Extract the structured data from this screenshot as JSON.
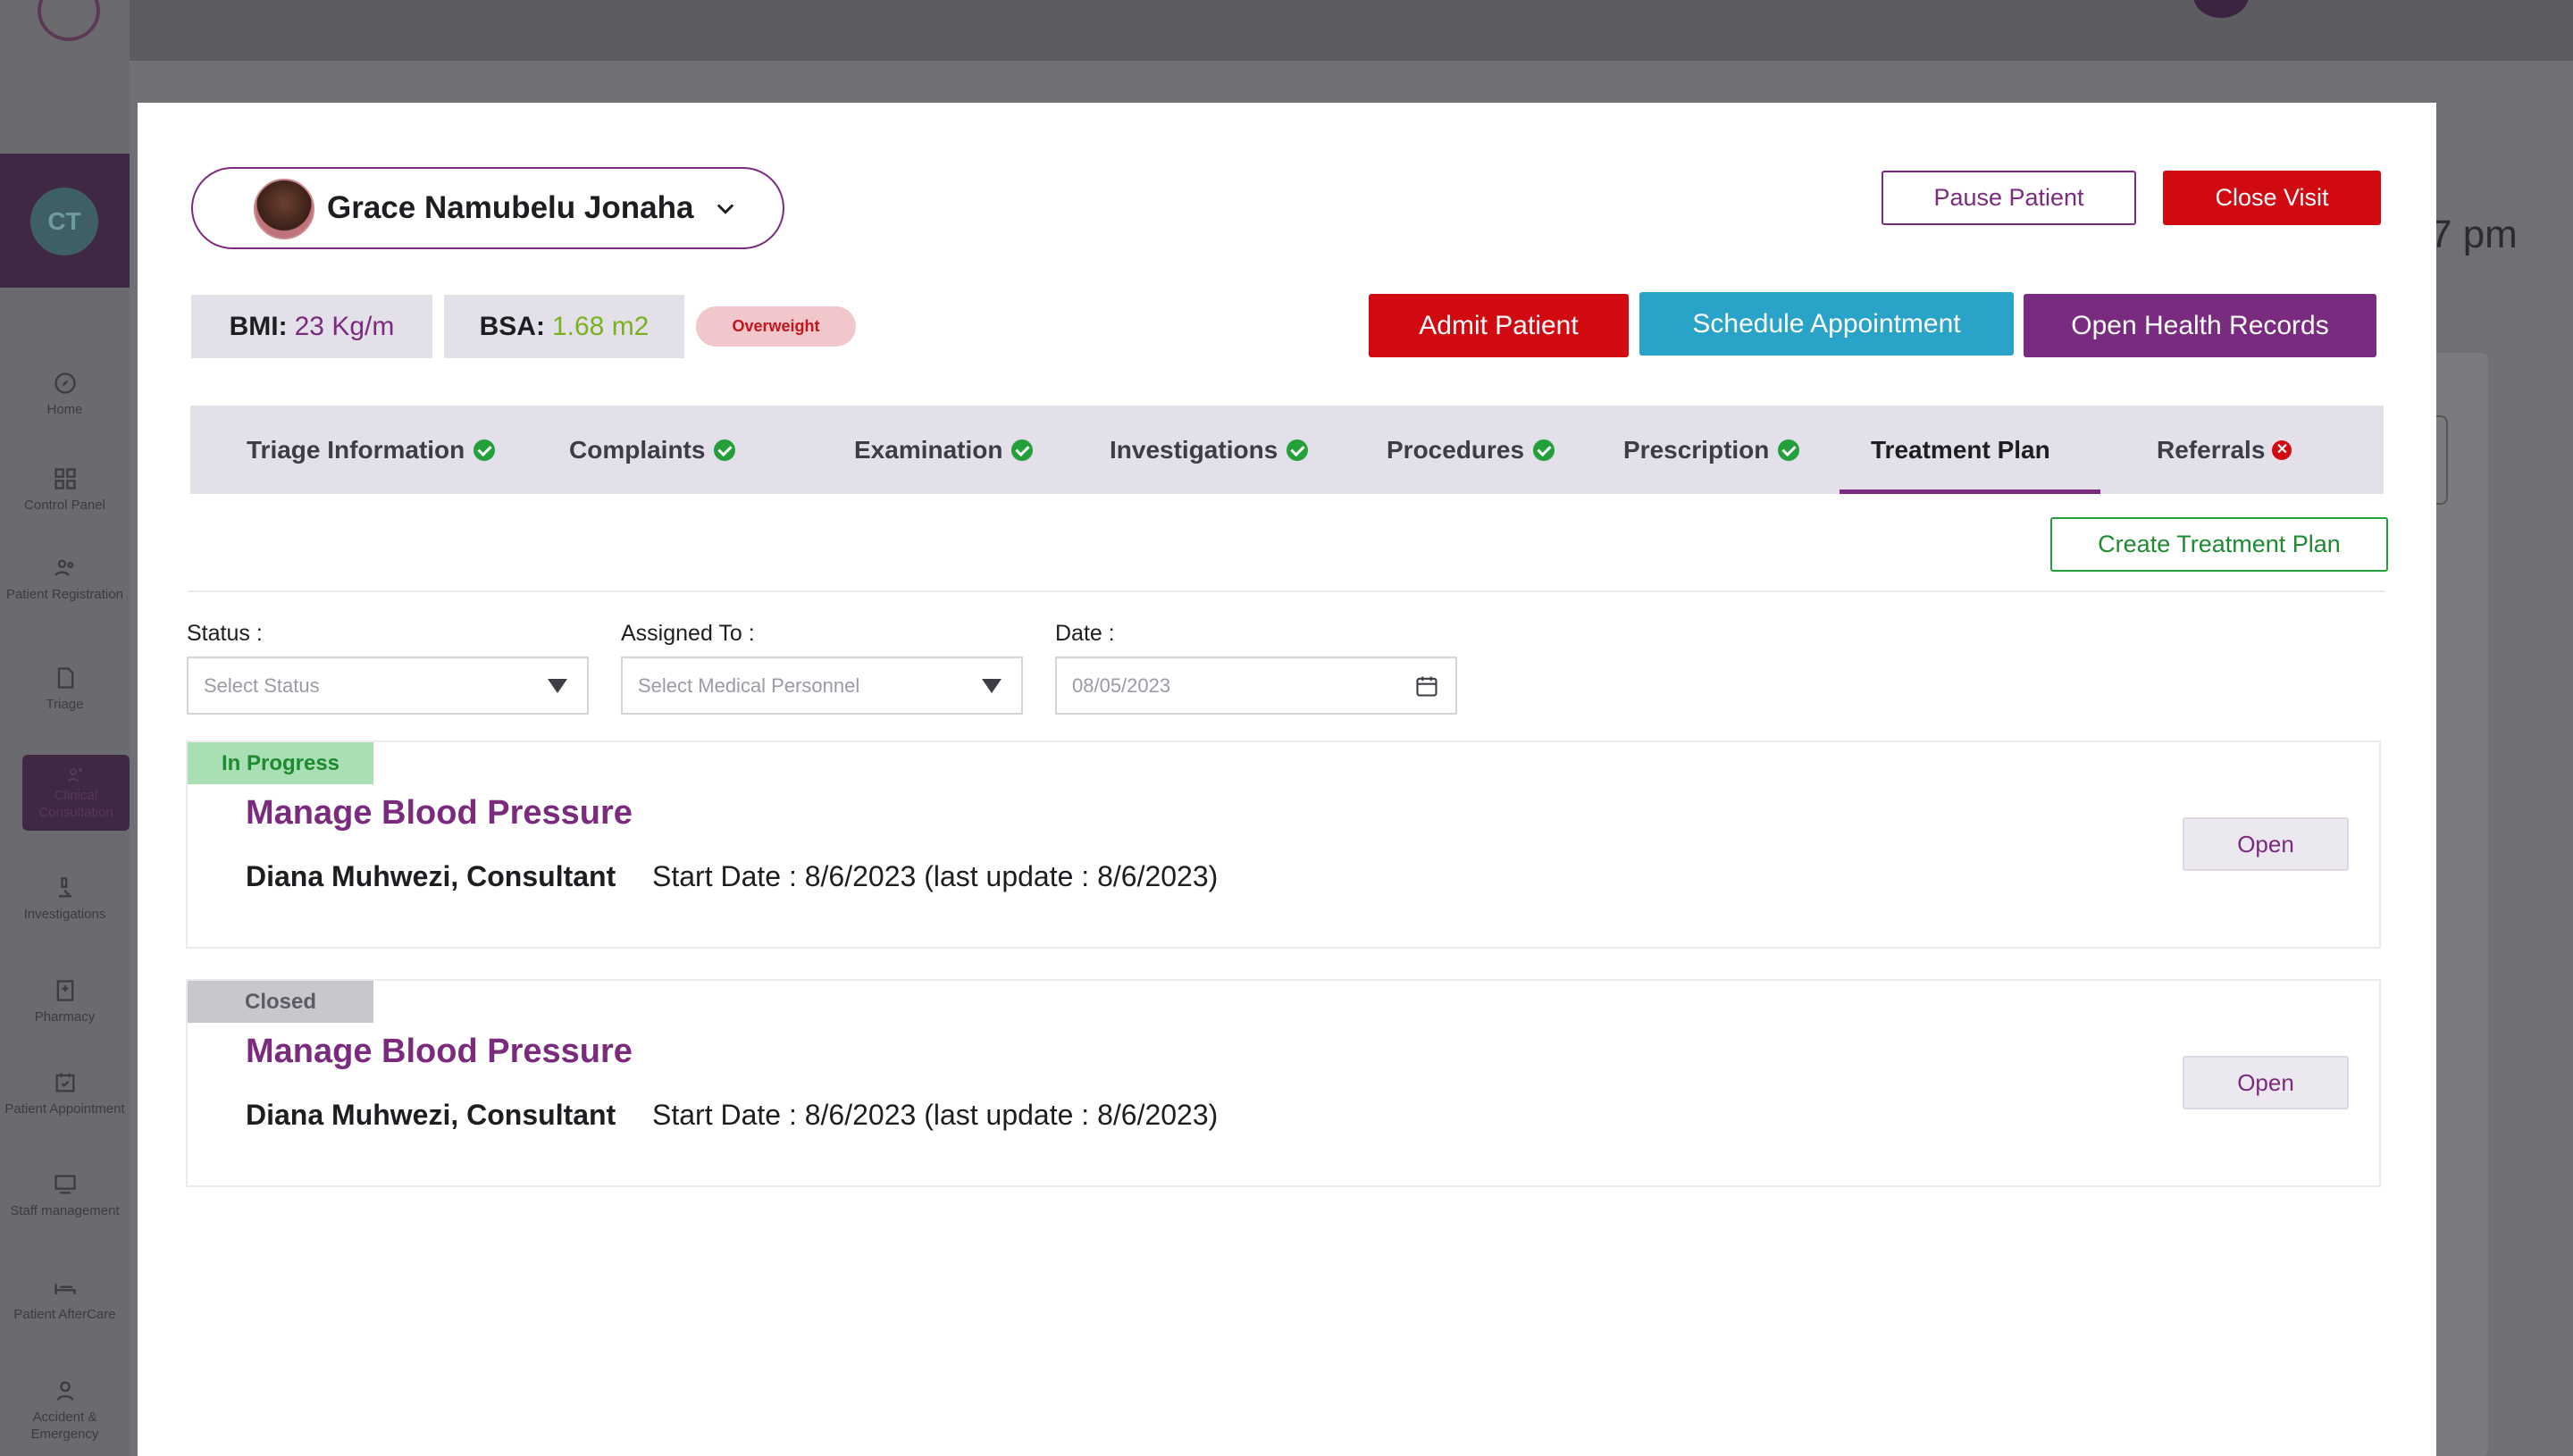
{
  "sidebar": {
    "user_initials": "CT",
    "items": [
      {
        "label": "Home",
        "icon": "compass-icon"
      },
      {
        "label": "Control Panel",
        "icon": "grid-icon"
      },
      {
        "label": "Patient Registration",
        "icon": "users-icon"
      },
      {
        "label": "Triage",
        "icon": "file-icon"
      },
      {
        "label": "Clinical Consultation",
        "icon": "consultation-icon"
      },
      {
        "label": "Investigations",
        "icon": "microscope-icon"
      },
      {
        "label": "Pharmacy",
        "icon": "building-icon"
      },
      {
        "label": "Patient Appointment",
        "icon": "calendar-icon"
      },
      {
        "label": "Staff management",
        "icon": "staff-icon"
      },
      {
        "label": "Patient AfterCare",
        "icon": "bed-icon"
      },
      {
        "label": "Accident & Emergency",
        "icon": "emergency-icon"
      }
    ]
  },
  "background": {
    "time_fragment": "7 pm"
  },
  "patient": {
    "name": "Grace Namubelu Jonaha"
  },
  "header_buttons": {
    "pause": "Pause Patient",
    "close": "Close Visit",
    "admit": "Admit Patient",
    "schedule": "Schedule Appointment",
    "records": "Open Health Records"
  },
  "metrics": {
    "bmi_label": "BMI:",
    "bmi_value": "23 Kg/m",
    "bsa_label": "BSA:",
    "bsa_value": "1.68 m2",
    "status_badge": "Overweight"
  },
  "tabs": [
    {
      "label": "Triage Information",
      "status": "complete"
    },
    {
      "label": "Complaints",
      "status": "complete"
    },
    {
      "label": "Examination",
      "status": "complete"
    },
    {
      "label": "Investigations",
      "status": "complete"
    },
    {
      "label": "Procedures",
      "status": "complete"
    },
    {
      "label": "Prescription",
      "status": "complete"
    },
    {
      "label": "Treatment Plan",
      "status": "active"
    },
    {
      "label": "Referrals",
      "status": "error"
    }
  ],
  "create_button": "Create Treatment Plan",
  "filters": {
    "status_label": "Status :",
    "status_placeholder": "Select Status",
    "assigned_label": "Assigned To :",
    "assigned_placeholder": "Select Medical Personnel",
    "date_label": "Date :",
    "date_value": "08/05/2023"
  },
  "plans": [
    {
      "status": "In Progress",
      "title": "Manage Blood Pressure",
      "person": "Diana Muhwezi, Consultant",
      "dates": "Start Date : 8/6/2023 (last update : 8/6/2023)",
      "action": "Open"
    },
    {
      "status": "Closed",
      "title": "Manage Blood Pressure",
      "person": "Diana Muhwezi, Consultant",
      "dates": "Start Date : 8/6/2023 (last update : 8/6/2023)",
      "action": "Open"
    }
  ],
  "colors": {
    "brand_purple": "#7a2b7e",
    "danger_red": "#d10a12",
    "info_blue": "#2aa3c8",
    "success_green": "#23a03a"
  }
}
